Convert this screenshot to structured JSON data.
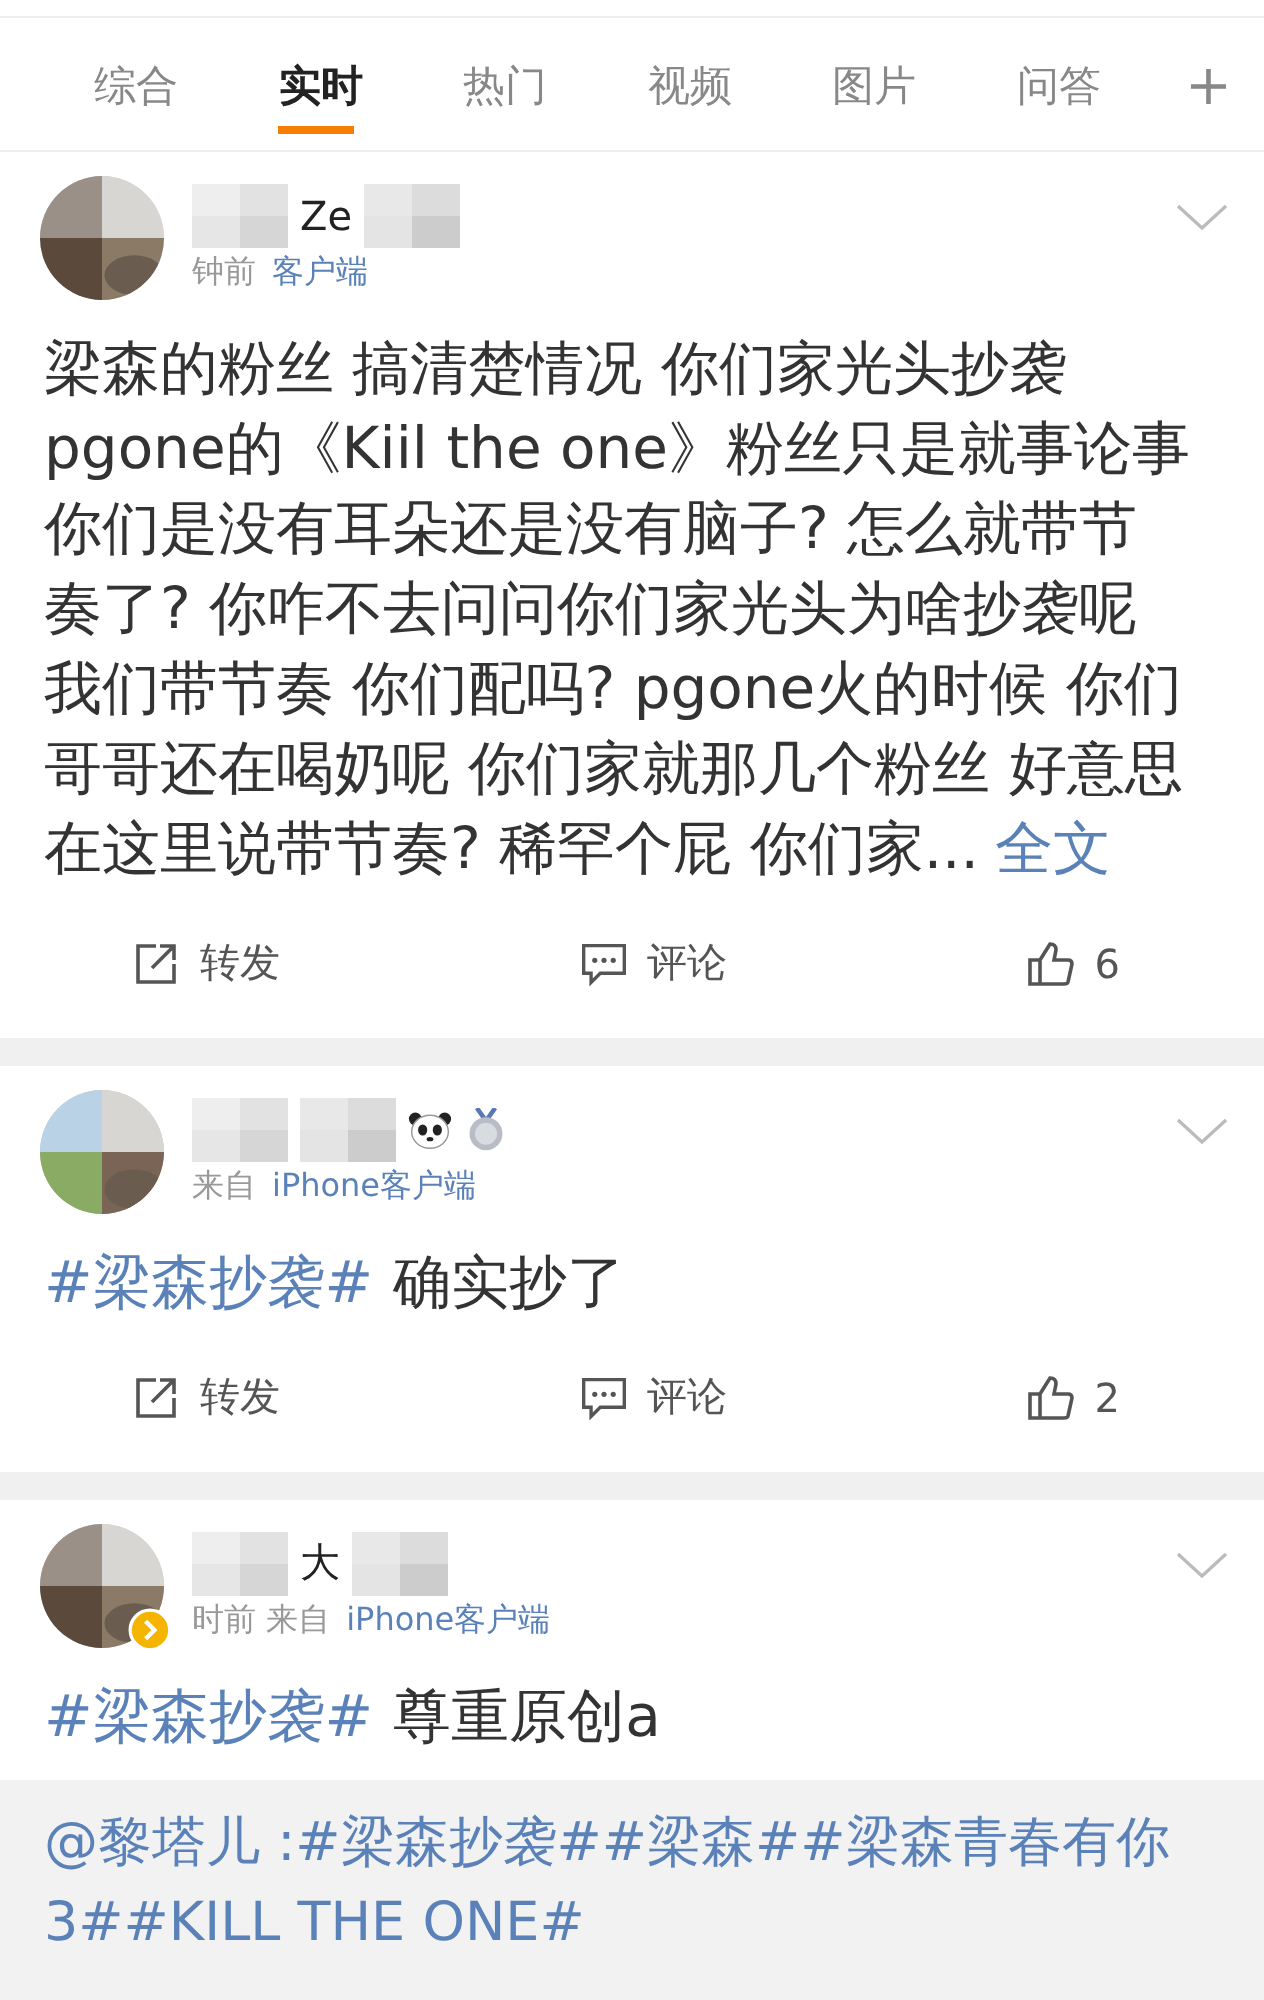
{
  "tabs": [
    {
      "label": "综合",
      "selected": false
    },
    {
      "label": "实时",
      "selected": true
    },
    {
      "label": "热门",
      "selected": false
    },
    {
      "label": "视频",
      "selected": false
    },
    {
      "label": "图片",
      "selected": false
    },
    {
      "label": "问答",
      "selected": false
    }
  ],
  "add_tab": "+",
  "posts": [
    {
      "name": "Ze",
      "meta": "钟前",
      "source": "客户端",
      "badge": false,
      "emblems": false,
      "lines": [
        [
          {
            "kind": "text",
            "text": "梁森的粉丝 搞清楚情况 你们家光头抄袭"
          }
        ],
        [
          {
            "kind": "text",
            "text": "pgone的《Kiil the one》粉丝只是就事论事"
          }
        ],
        [
          {
            "kind": "text",
            "text": "你们是没有耳朵还是没有脑子? 怎么就带节"
          }
        ],
        [
          {
            "kind": "text",
            "text": "奏了? 你咋不去问问你们家光头为啥抄袭呢"
          }
        ],
        [
          {
            "kind": "text",
            "text": "我们带节奏 你们配吗? pgone火的时候 你们"
          }
        ],
        [
          {
            "kind": "text",
            "text": "哥哥还在喝奶呢 你们家就那几个粉丝 好意思"
          }
        ],
        [
          {
            "kind": "text",
            "text": "在这里说带节奏? 稀罕个屁 你们家..."
          },
          {
            "kind": "link",
            "text": "全文"
          }
        ]
      ],
      "actions": {
        "repost": "转发",
        "comment": "评论",
        "likes": "6"
      }
    },
    {
      "meta": "来自",
      "source": "iPhone客户端",
      "badge": false,
      "emblems": true,
      "lines": [
        [
          {
            "kind": "hashtag",
            "text": "#梁森抄袭#"
          },
          {
            "kind": "text",
            "text": "确实抄了"
          }
        ]
      ],
      "actions": {
        "repost": "转发",
        "comment": "评论",
        "likes": "2"
      }
    },
    {
      "name": "大",
      "meta": "时前 来自",
      "source": "iPhone客户端",
      "badge": true,
      "emblems": false,
      "lines": [
        [
          {
            "kind": "hashtag",
            "text": "#梁森抄袭#"
          },
          {
            "kind": "text",
            "text": "尊重原创a"
          }
        ]
      ],
      "repost": "@黎塔儿 :#梁森抄袭##梁森##梁森青春有你3##KILL THE ONE#"
    }
  ]
}
